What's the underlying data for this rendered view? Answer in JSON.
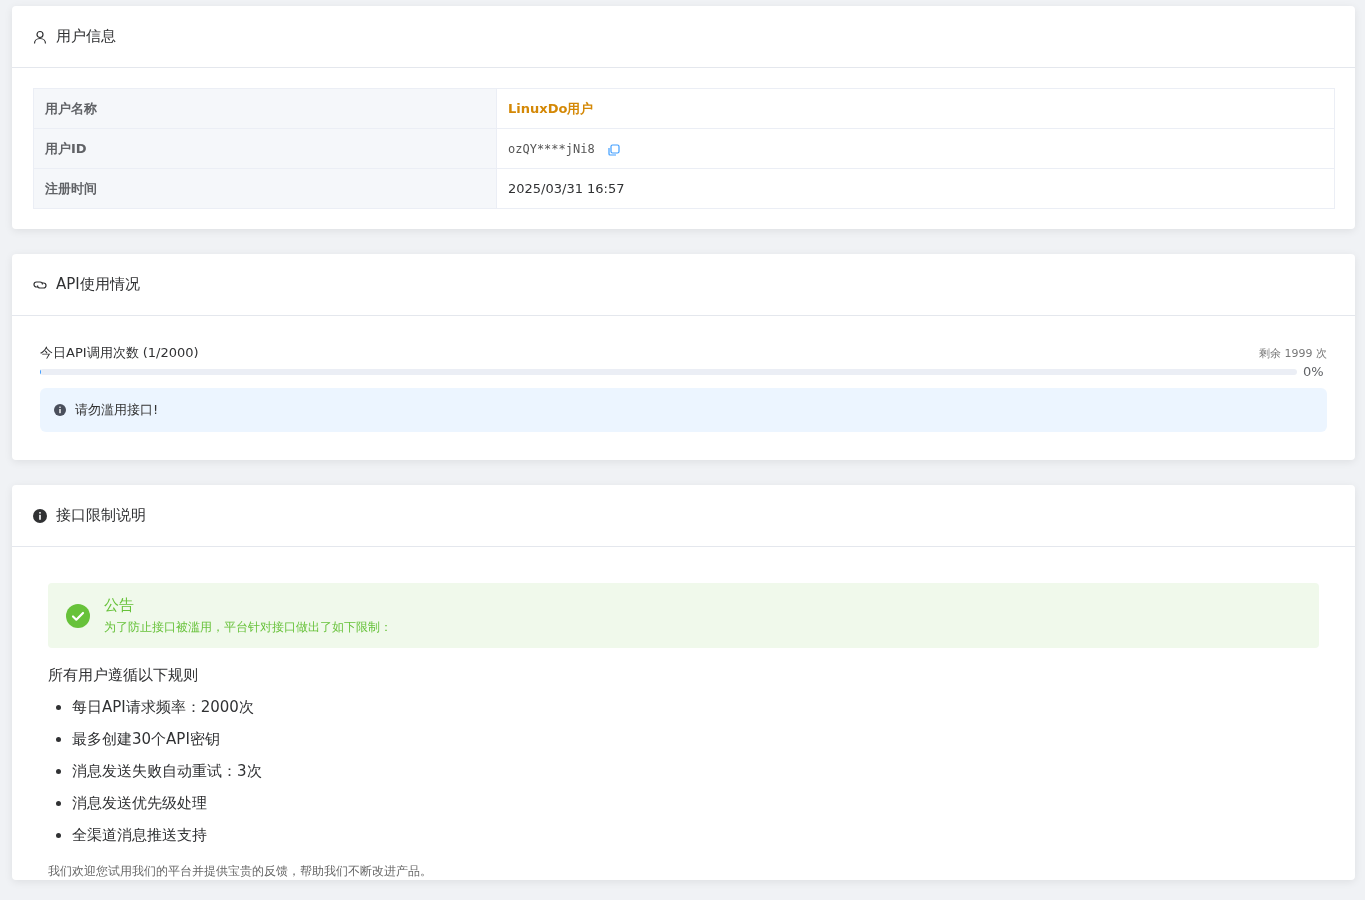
{
  "user_info": {
    "title": "用户信息",
    "rows": [
      {
        "label": "用户名称",
        "value": "LinuxDo用户",
        "kind": "name"
      },
      {
        "label": "用户ID",
        "value": "ozQY****jNi8",
        "kind": "id"
      },
      {
        "label": "注册时间",
        "value": "2025/03/31 16:57",
        "kind": "text"
      }
    ]
  },
  "api_usage": {
    "title": "API使用情况",
    "label": "今日API调用次数 (1/2000)",
    "remaining": "剩余 1999 次",
    "level": 0.0005,
    "percent": "0%",
    "notice": "请勿滥用接口!"
  },
  "limits": {
    "title": "接口限制说明",
    "alert": {
      "title": "公告",
      "text": "为了防止接口被滥用，平台针对接口做出了如下限制："
    },
    "intro": "所有用户遵循以下规则",
    "rules": [
      "每日API请求频率：2000次",
      "最多创建30个API密钥",
      "消息发送失败自动重试：3次",
      "消息发送优先级处理",
      "全渠道消息推送支持"
    ],
    "footer": "我们欢迎您试用我们的平台并提供宝贵的反馈，帮助我们不断改进产品。"
  }
}
